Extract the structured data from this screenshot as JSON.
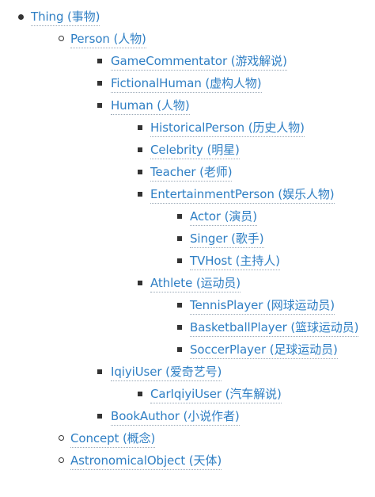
{
  "tree": {
    "thing": "Thing (事物)",
    "person": "Person (人物)",
    "game_commentator": "GameCommentator (游戏解说)",
    "fictional_human": "FictionalHuman (虚构人物)",
    "human": "Human (人物)",
    "historical_person": "HistoricalPerson (历史人物)",
    "celebrity": "Celebrity (明星)",
    "teacher": "Teacher (老师)",
    "entertainment_person": "EntertainmentPerson (娱乐人物)",
    "actor": "Actor (演员)",
    "singer": "Singer (歌手)",
    "tvhost": "TVHost (主持人)",
    "athlete": "Athlete (运动员)",
    "tennis_player": "TennisPlayer (网球运动员)",
    "basketball_player": "BasketballPlayer (篮球运动员)",
    "soccer_player": "SoccerPlayer (足球运动员)",
    "iqiyi_user": "IqiyiUser (爱奇艺号)",
    "car_iqiyi_user": "CarIqiyiUser (汽车解说)",
    "book_author": "BookAuthor (小说作者)",
    "concept": "Concept (概念)",
    "astronomical_object": "AstronomicalObject (天体)"
  },
  "colors": {
    "link": "#2f7fc4",
    "bullet": "#333333",
    "underline": "#9aa8b6"
  }
}
